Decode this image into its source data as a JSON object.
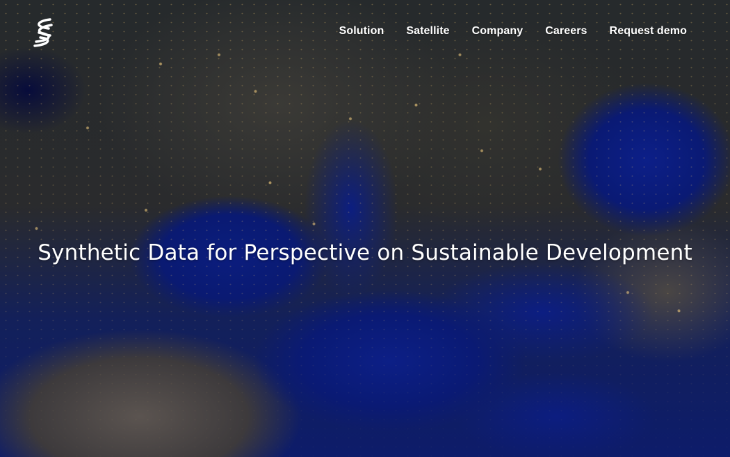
{
  "nav": {
    "items": [
      {
        "label": "Solution"
      },
      {
        "label": "Satellite"
      },
      {
        "label": "Company"
      },
      {
        "label": "Careers"
      },
      {
        "label": "Request demo"
      }
    ]
  },
  "hero": {
    "headline": "Synthetic Data for Perspective on Sustainable Development",
    "background": "night-time satellite image of Europe and the Mediterranean with city lights"
  },
  "logo": {
    "icon": "stylized-s-logo-icon"
  },
  "colors": {
    "text": "#ffffff",
    "sea": "#0c1f86",
    "city_lights": "#ffd682"
  }
}
